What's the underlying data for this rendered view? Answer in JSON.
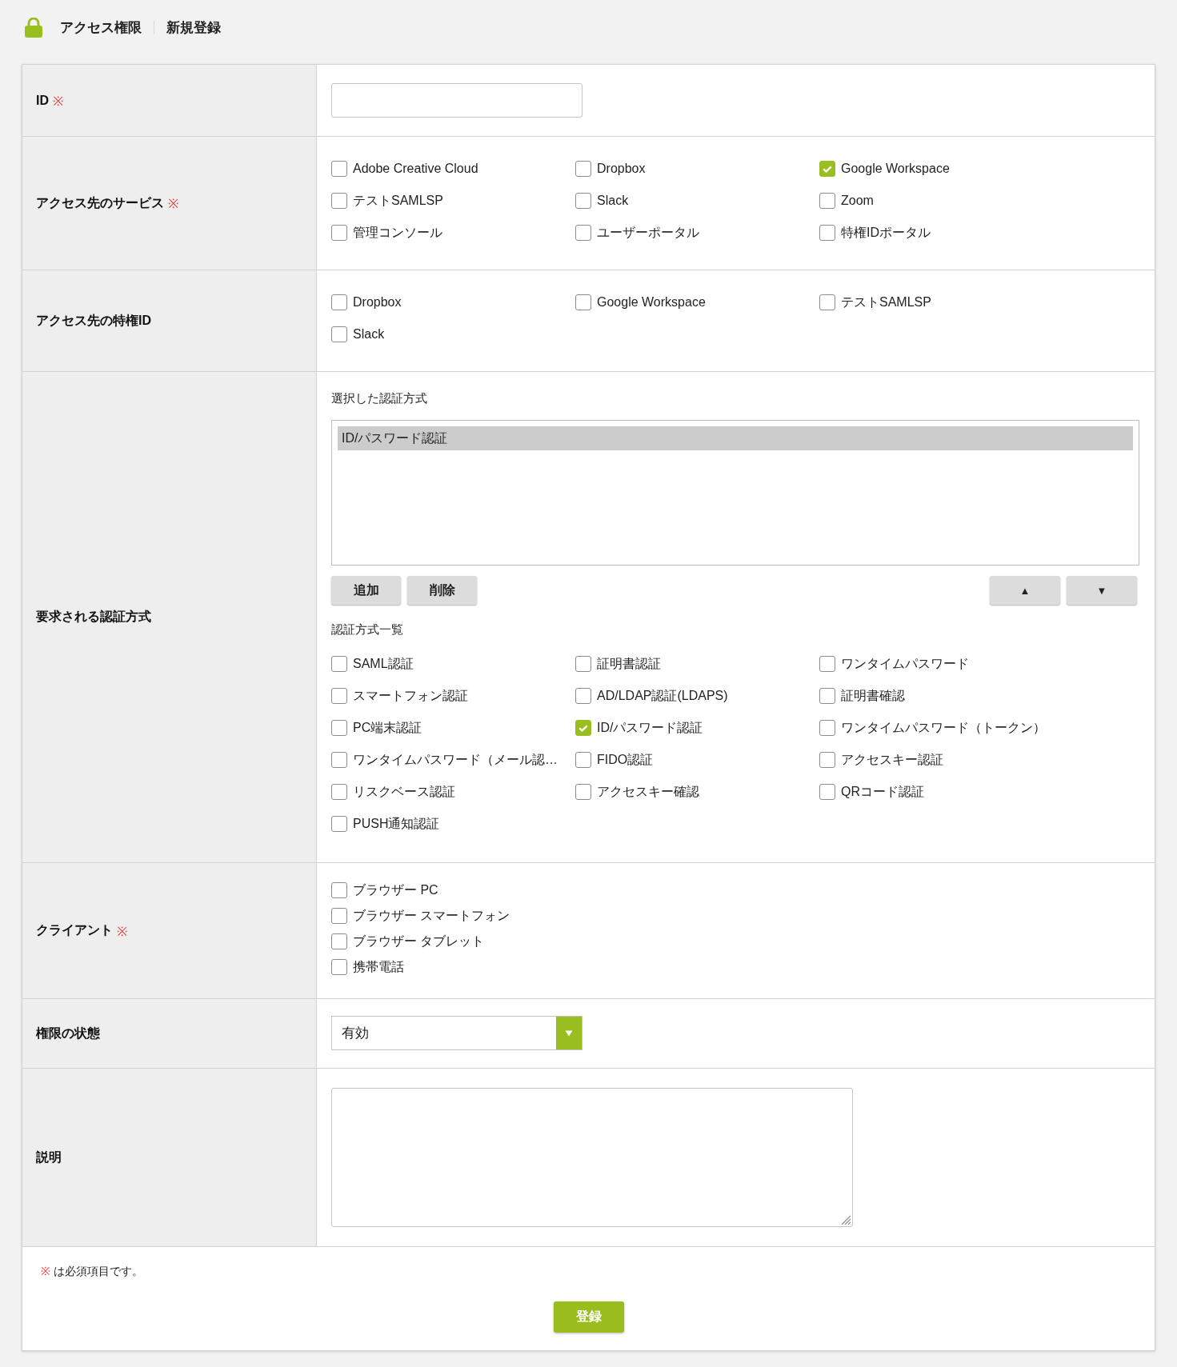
{
  "header": {
    "title": "アクセス権限",
    "subtitle": "新規登録"
  },
  "form": {
    "rows": [
      {
        "kind": "input",
        "label": "ID",
        "required_mark": "※"
      },
      {
        "kind": "checkbox_grid",
        "label": "アクセス先のサービス",
        "required_mark": "※",
        "options": [
          {
            "label": "Adobe Creative Cloud",
            "checked": false
          },
          {
            "label": "Dropbox",
            "checked": false
          },
          {
            "label": "Google Workspace",
            "checked": true
          },
          {
            "label": "テストSAMLSP",
            "checked": false
          },
          {
            "label": "Slack",
            "checked": false
          },
          {
            "label": "Zoom",
            "checked": false
          },
          {
            "label": "管理コンソール",
            "checked": false
          },
          {
            "label": "ユーザーポータル",
            "checked": false
          },
          {
            "label": "特権IDポータル",
            "checked": false
          }
        ]
      },
      {
        "kind": "checkbox_grid",
        "label": "アクセス先の特権ID",
        "options": [
          {
            "label": "Dropbox",
            "checked": false
          },
          {
            "label": "Google Workspace",
            "checked": false
          },
          {
            "label": "テストSAMLSP",
            "checked": false
          },
          {
            "label": "Slack",
            "checked": false
          }
        ]
      },
      {
        "kind": "auth_methods",
        "label": "要求される認証方式",
        "selected_heading": "選択した認証方式",
        "selected_items": [
          {
            "label": "ID/パスワード認証",
            "selected": true
          }
        ],
        "buttons": [
          {
            "label": "追加"
          },
          {
            "label": "削除"
          }
        ],
        "order_buttons": [
          {
            "label": "▲"
          },
          {
            "label": "▼"
          }
        ],
        "list_heading": "認証方式一覧",
        "options": [
          {
            "label": "SAML認証",
            "checked": false
          },
          {
            "label": "証明書認証",
            "checked": false
          },
          {
            "label": "ワンタイムパスワード",
            "checked": false
          },
          {
            "label": "スマートフォン認証",
            "checked": false
          },
          {
            "label": "AD/LDAP認証(LDAPS)",
            "checked": false
          },
          {
            "label": "証明書確認",
            "checked": false
          },
          {
            "label": "PC端末認証",
            "checked": false
          },
          {
            "label": "ID/パスワード認証",
            "checked": true
          },
          {
            "label": "ワンタイムパスワード（トークン）",
            "checked": false
          },
          {
            "label": "ワンタイムパスワード（メール認…",
            "checked": false
          },
          {
            "label": "FIDO認証",
            "checked": false
          },
          {
            "label": "アクセスキー認証",
            "checked": false
          },
          {
            "label": "リスクベース認証",
            "checked": false
          },
          {
            "label": "アクセスキー確認",
            "checked": false
          },
          {
            "label": "QRコード認証",
            "checked": false
          },
          {
            "label": "PUSH通知認証",
            "checked": false
          }
        ]
      },
      {
        "kind": "checkbox_stack",
        "label": "クライアント",
        "required_mark": "※",
        "options": [
          {
            "label": "ブラウザー PC",
            "checked": false
          },
          {
            "label": "ブラウザー スマートフォン",
            "checked": false
          },
          {
            "label": "ブラウザー タブレット",
            "checked": false
          },
          {
            "label": "携帯電話",
            "checked": false
          }
        ]
      },
      {
        "kind": "select",
        "label": "権限の状態",
        "value": "有効"
      },
      {
        "kind": "textarea",
        "label": "説明"
      }
    ]
  },
  "footer": {
    "note_mark": "※",
    "note": "は必須項目です。",
    "submit": "登録"
  }
}
